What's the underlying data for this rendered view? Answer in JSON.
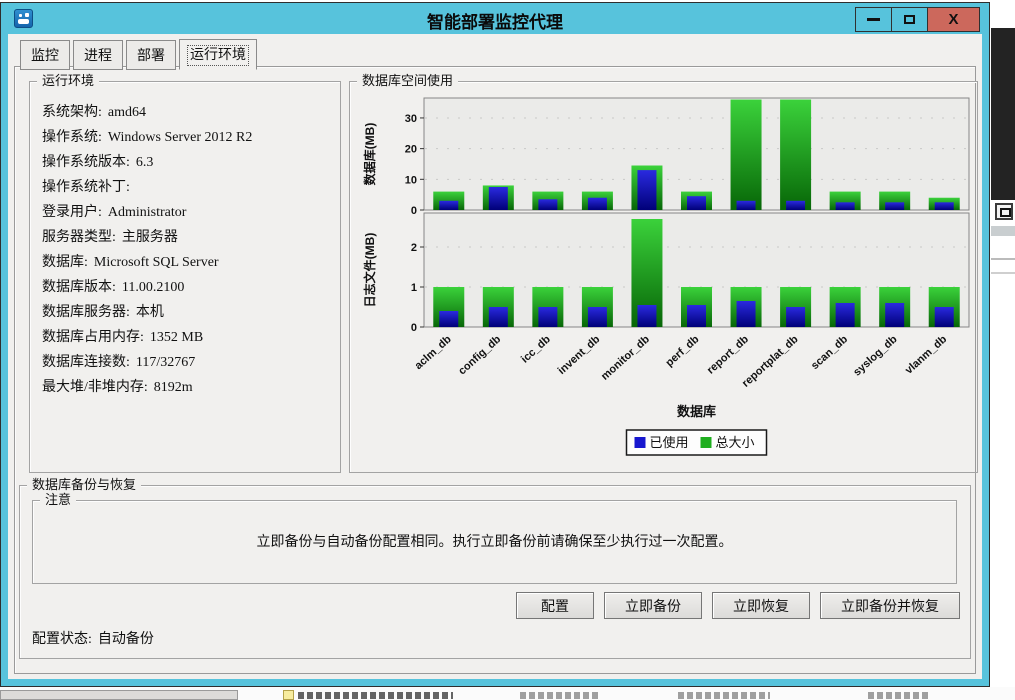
{
  "window": {
    "title": "智能部署监控代理",
    "controls": {
      "close_label": "X"
    }
  },
  "tabs": [
    {
      "label": "监控"
    },
    {
      "label": "进程"
    },
    {
      "label": "部署"
    },
    {
      "label": "运行环境",
      "selected": true
    }
  ],
  "env": {
    "title": "运行环境",
    "fields": [
      {
        "label": "系统架构:",
        "value": "amd64"
      },
      {
        "label": "操作系统:",
        "value": "Windows Server 2012 R2"
      },
      {
        "label": "操作系统版本:",
        "value": "6.3"
      },
      {
        "label": "操作系统补丁:",
        "value": ""
      },
      {
        "label": "登录用户:",
        "value": "Administrator"
      },
      {
        "label": "服务器类型:",
        "value": "主服务器"
      },
      {
        "label": "数据库:",
        "value": "Microsoft SQL Server"
      },
      {
        "label": "数据库版本:",
        "value": "11.00.2100"
      },
      {
        "label": "数据库服务器:",
        "value": "本机"
      },
      {
        "label": "数据库占用内存:",
        "value": "1352 MB"
      },
      {
        "label": "数据库连接数:",
        "value": "117/32767"
      },
      {
        "label": "最大堆/非堆内存:",
        "value": "8192m"
      }
    ]
  },
  "chart_group": {
    "title": "数据库空间使用"
  },
  "chart_data": {
    "type": "bar",
    "categories": [
      "aclm_db",
      "config_db",
      "icc_db",
      "invent_db",
      "monitor_db",
      "perf_db",
      "report_db",
      "reportplat_db",
      "scan_db",
      "syslog_db",
      "vlanm_db"
    ],
    "xlabel": "数据库",
    "legend": [
      {
        "label": "已使用",
        "color": "#1717cf"
      },
      {
        "label": "总大小",
        "color": "#1fae1f"
      }
    ],
    "charts": [
      {
        "ylabel": "数据库(MB)",
        "yticks": [
          0,
          10,
          20,
          30
        ],
        "ymax": 36.5,
        "series": [
          {
            "name": "总大小",
            "gradient": [
              "#3bd23b",
              "#076607"
            ],
            "values": [
              6,
              8,
              6,
              6,
              14.5,
              6,
              36,
              36,
              6,
              6,
              4
            ]
          },
          {
            "name": "已使用",
            "gradient": [
              "#2a2ae0",
              "#000078"
            ],
            "values": [
              3,
              7.5,
              3.5,
              4,
              13,
              4.5,
              3,
              3,
              2.5,
              2.5,
              2.5
            ]
          }
        ]
      },
      {
        "ylabel": "日志文件(MB)",
        "yticks": [
          0,
          1,
          2
        ],
        "ymax": 2.85,
        "series": [
          {
            "name": "总大小",
            "gradient": [
              "#3bd23b",
              "#076607"
            ],
            "values": [
              1,
              1,
              1,
              1,
              2.7,
              1,
              1,
              1,
              1,
              1,
              1
            ]
          },
          {
            "name": "已使用",
            "gradient": [
              "#2a2ae0",
              "#000078"
            ],
            "values": [
              0.4,
              0.5,
              0.5,
              0.5,
              0.55,
              0.55,
              0.65,
              0.5,
              0.6,
              0.6,
              0.5
            ]
          }
        ]
      }
    ]
  },
  "backup": {
    "title": "数据库备份与恢复",
    "note_title": "注意",
    "note_text": "立即备份与自动备份配置相同。执行立即备份前请确保至少执行过一次配置。",
    "buttons": [
      {
        "label": "配置"
      },
      {
        "label": "立即备份"
      },
      {
        "label": "立即恢复"
      },
      {
        "label": "立即备份并恢复"
      }
    ],
    "status_label": "配置状态:",
    "status_value": "自动备份"
  }
}
